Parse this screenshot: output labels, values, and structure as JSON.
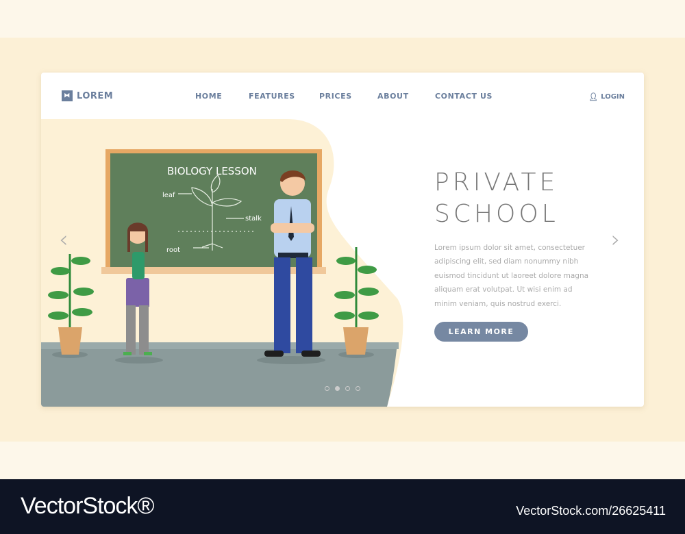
{
  "nav": {
    "logo": "LOREM",
    "items": [
      "HOME",
      "FEATURES",
      "PRICES",
      "ABOUT",
      "CONTACT US"
    ],
    "login": "LOGIN"
  },
  "hero": {
    "title_line1": "PRIVATE",
    "title_line2": "SCHOOL",
    "description": "Lorem ipsum dolor sit amet, consectetuer adipiscing elit, sed diam nonummy nibh euismod tincidunt ut laoreet dolore magna aliquam erat volutpat. Ut wisi enim ad minim veniam, quis nostrud exerci.",
    "button": "LEARN MORE",
    "slides": 4,
    "active_slide": 2
  },
  "board": {
    "title": "BIOLOGY LESSON",
    "leaf": "leaf",
    "stalk": "stalk",
    "root": "root"
  },
  "watermark": {
    "brand": "VectorStock®",
    "id": "VectorStock.com/26625411"
  },
  "colors": {
    "accent": "#7688a2",
    "board": "#5f7f5b",
    "floor": "#8b9b9b"
  }
}
